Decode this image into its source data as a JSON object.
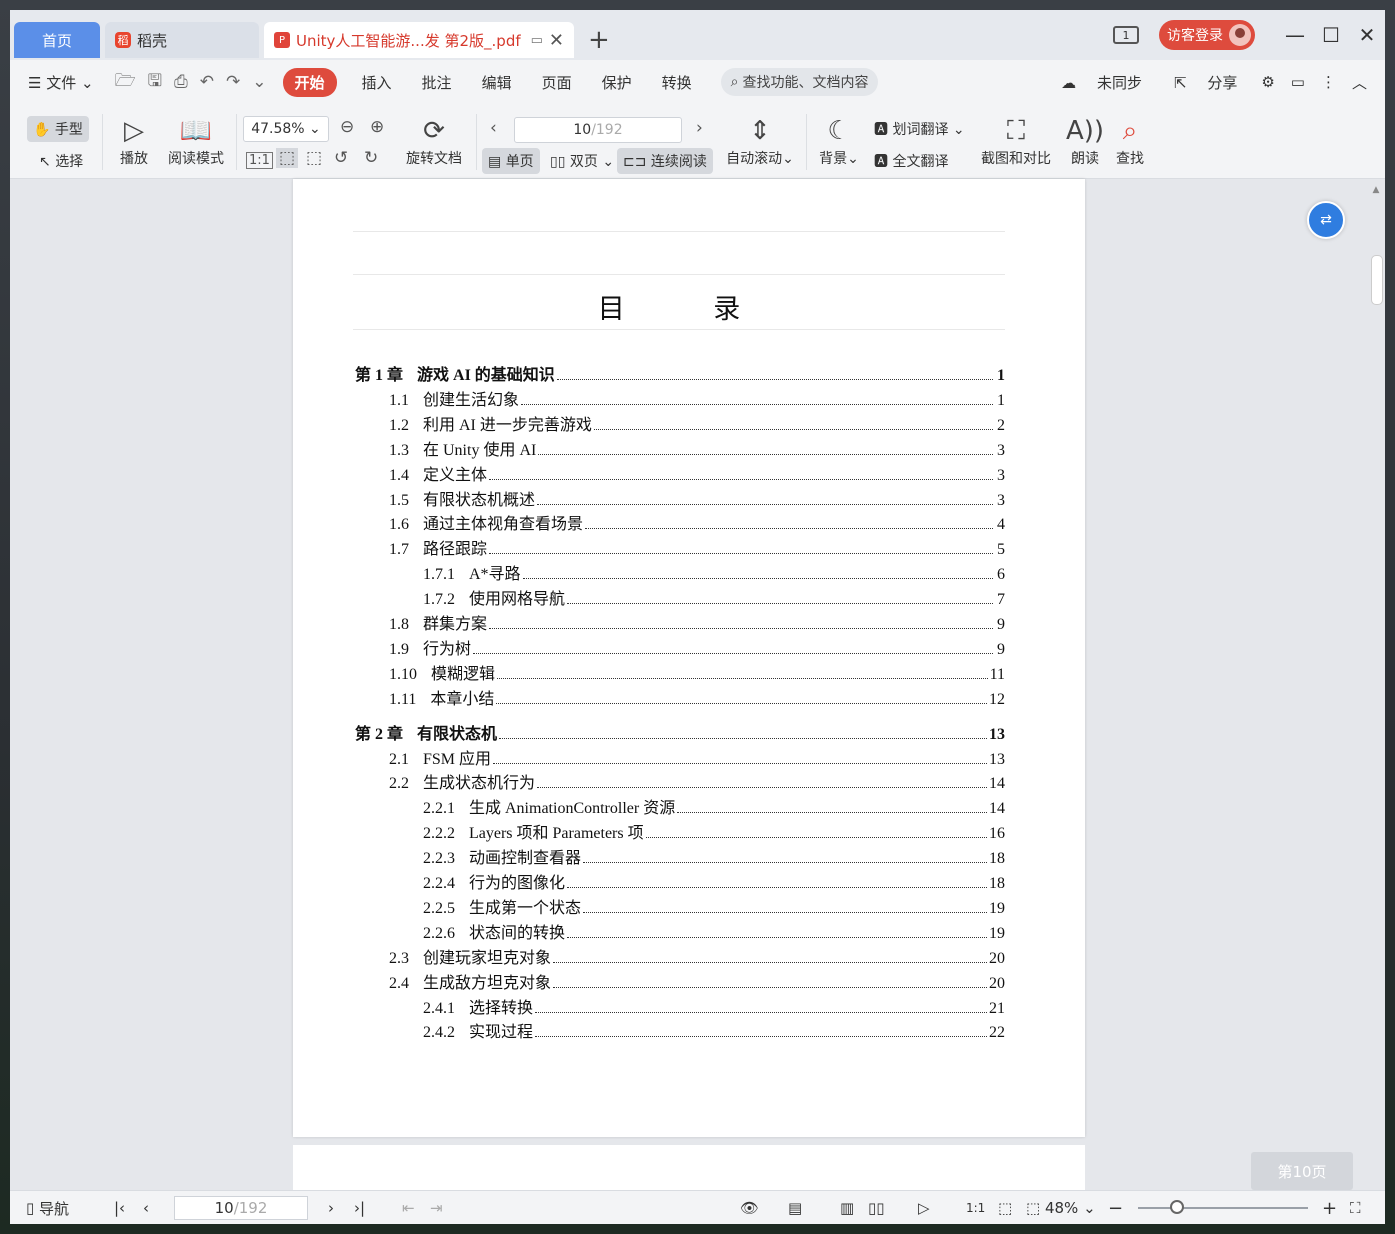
{
  "tabs": {
    "home": "首页",
    "daoke": "稻壳",
    "document": "Unity人工智能游...发 第2版_.pdf"
  },
  "titlebar": {
    "page_badge": "1",
    "login": "访客登录"
  },
  "menu": {
    "file": "文件",
    "items": [
      "开始",
      "插入",
      "批注",
      "编辑",
      "页面",
      "保护",
      "转换"
    ],
    "search_placeholder": "查找功能、文档内容",
    "sync": "未同步",
    "share": "分享"
  },
  "ribbon": {
    "hand": "手型",
    "select": "选择",
    "play": "播放",
    "read_mode": "阅读模式",
    "zoom": "47.58%",
    "rotate": "旋转文档",
    "page_current": "10",
    "page_total": "/192",
    "single": "单页",
    "double": "双页",
    "continuous": "连续阅读",
    "auto_scroll": "自动滚动",
    "background": "背景",
    "word_translate": "划词翻译",
    "full_translate": "全文翻译",
    "screenshot": "截图和对比",
    "read_aloud": "朗读",
    "find": "查找"
  },
  "document": {
    "toc_title": "目 录",
    "toc": [
      {
        "level": 0,
        "num": "第 1 章",
        "label": "游戏 AI 的基础知识",
        "page": "1"
      },
      {
        "level": 1,
        "num": "1.1",
        "label": "创建生活幻象",
        "page": "1"
      },
      {
        "level": 1,
        "num": "1.2",
        "label": "利用 AI 进一步完善游戏",
        "page": "2"
      },
      {
        "level": 1,
        "num": "1.3",
        "label": "在 Unity 使用 AI",
        "page": "3"
      },
      {
        "level": 1,
        "num": "1.4",
        "label": "定义主体",
        "page": "3"
      },
      {
        "level": 1,
        "num": "1.5",
        "label": "有限状态机概述",
        "page": "3"
      },
      {
        "level": 1,
        "num": "1.6",
        "label": "通过主体视角查看场景",
        "page": "4"
      },
      {
        "level": 1,
        "num": "1.7",
        "label": "路径跟踪",
        "page": "5"
      },
      {
        "level": 2,
        "num": "1.7.1",
        "label": "A*寻路",
        "page": "6"
      },
      {
        "level": 2,
        "num": "1.7.2",
        "label": "使用网格导航",
        "page": "7"
      },
      {
        "level": 1,
        "num": "1.8",
        "label": "群集方案",
        "page": "9"
      },
      {
        "level": 1,
        "num": "1.9",
        "label": "行为树",
        "page": "9"
      },
      {
        "level": 1,
        "num": "1.10",
        "label": "模糊逻辑",
        "page": "11"
      },
      {
        "level": 1,
        "num": "1.11",
        "label": "本章小结",
        "page": "12"
      },
      {
        "level": 0,
        "num": "第 2 章",
        "label": "有限状态机",
        "page": "13"
      },
      {
        "level": 1,
        "num": "2.1",
        "label": "FSM 应用",
        "page": "13"
      },
      {
        "level": 1,
        "num": "2.2",
        "label": "生成状态机行为",
        "page": "14"
      },
      {
        "level": 2,
        "num": "2.2.1",
        "label": "生成 AnimationController 资源",
        "page": "14"
      },
      {
        "level": 2,
        "num": "2.2.2",
        "label": "Layers 项和 Parameters 项",
        "page": "16"
      },
      {
        "level": 2,
        "num": "2.2.3",
        "label": "动画控制查看器",
        "page": "18"
      },
      {
        "level": 2,
        "num": "2.2.4",
        "label": "行为的图像化",
        "page": "18"
      },
      {
        "level": 2,
        "num": "2.2.5",
        "label": "生成第一个状态",
        "page": "19"
      },
      {
        "level": 2,
        "num": "2.2.6",
        "label": "状态间的转换",
        "page": "19"
      },
      {
        "level": 1,
        "num": "2.3",
        "label": "创建玩家坦克对象",
        "page": "20"
      },
      {
        "level": 1,
        "num": "2.4",
        "label": "生成敌方坦克对象",
        "page": "20"
      },
      {
        "level": 2,
        "num": "2.4.1",
        "label": "选择转换",
        "page": "21"
      },
      {
        "level": 2,
        "num": "2.4.2",
        "label": "实现过程",
        "page": "22"
      }
    ],
    "page_hint": "第10页"
  },
  "status": {
    "nav": "导航",
    "page_current": "10",
    "page_total": "/192",
    "zoom": "48%"
  },
  "colors": {
    "accent": "#de4b3d",
    "home_tab": "#5b8fe8",
    "fab": "#2f7de0"
  }
}
